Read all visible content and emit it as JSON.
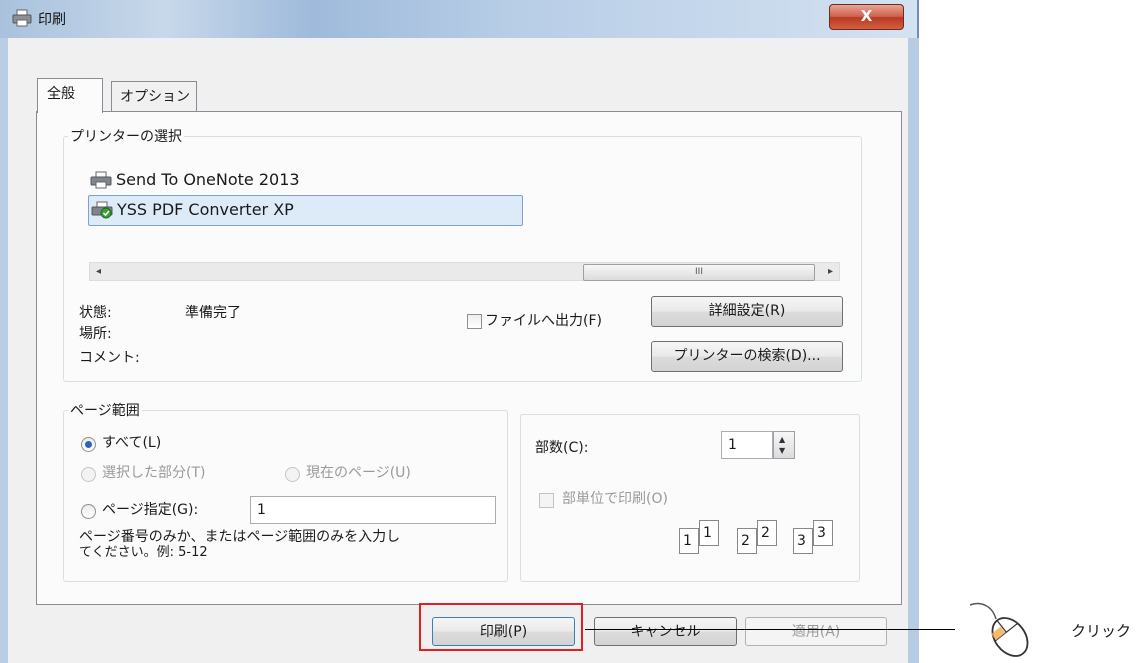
{
  "window": {
    "title": "印刷",
    "close_label": "X"
  },
  "tabs": {
    "general": "全般",
    "options": "オプション"
  },
  "printer_group": {
    "legend": "プリンターの選択",
    "printers": [
      "Send To OneNote 2013",
      "YSS PDF Converter XP"
    ],
    "selected_index": 1,
    "scroll_left": "◂",
    "scroll_right": "▸",
    "scroll_thumb_grip": "III",
    "status_label": "状態:",
    "status_value": "準備完了",
    "location_label": "場所:",
    "comment_label": "コメント:",
    "print_to_file_label": "ファイルへ出力(F)",
    "print_to_file_checked": false,
    "preferences_button": "詳細設定(R)",
    "find_printer_button": "プリンターの検索(D)..."
  },
  "range_group": {
    "legend": "ページ範囲",
    "all_label": "すべて(L)",
    "selection_label": "選択した部分(T)",
    "current_page_label": "現在のページ(U)",
    "pages_label": "ページ指定(G):",
    "pages_value": "1",
    "hint_line1": "ページ番号のみか、またはページ範囲のみを入力し",
    "hint_line2": "てください。例: 5-12",
    "selected_option": "all"
  },
  "copies_group": {
    "copies_label": "部数(C):",
    "copies_value": "1",
    "collate_label": "部単位で印刷(O)",
    "collate_checked": false,
    "collate_pages": [
      "1",
      "1",
      "2",
      "2",
      "3",
      "3"
    ]
  },
  "buttons": {
    "print": "印刷(P)",
    "cancel": "キャンセル",
    "apply": "適用(A)"
  },
  "annotation": {
    "click_label": "クリック"
  }
}
